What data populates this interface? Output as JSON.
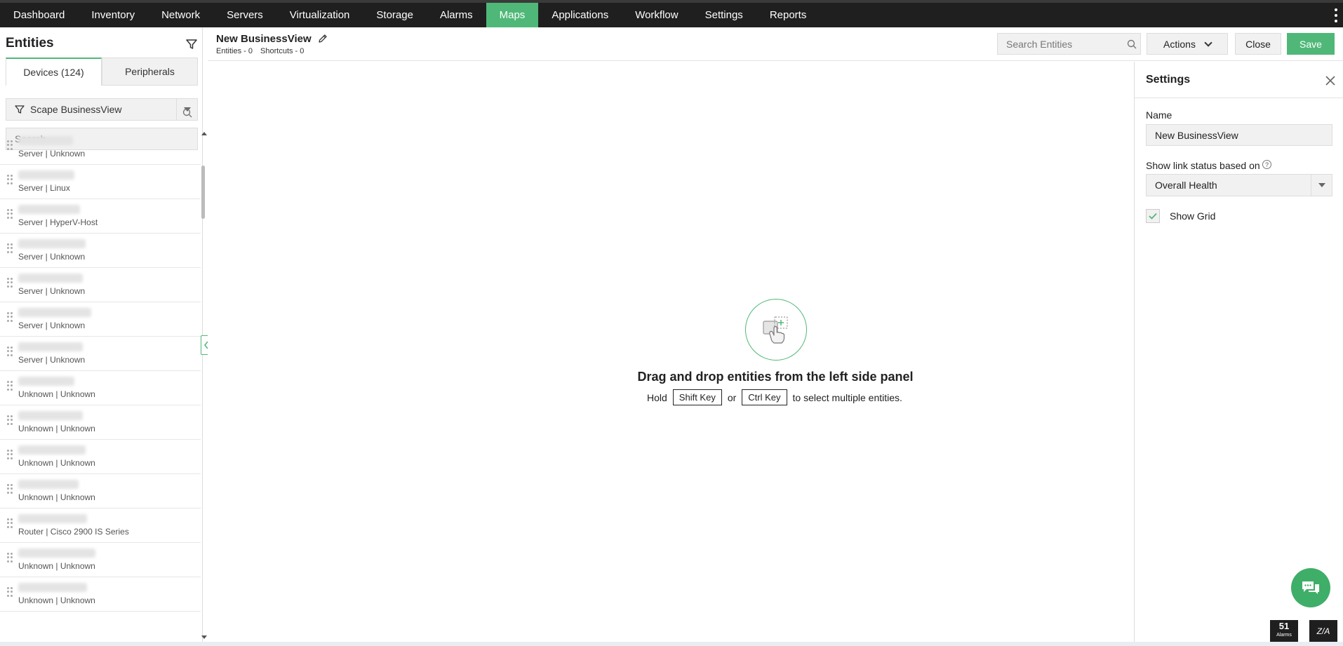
{
  "nav": {
    "items": [
      "Dashboard",
      "Inventory",
      "Network",
      "Servers",
      "Virtualization",
      "Storage",
      "Alarms",
      "Maps",
      "Applications",
      "Workflow",
      "Settings",
      "Reports"
    ],
    "active": "Maps"
  },
  "left": {
    "title": "Entities",
    "tabs": [
      "Devices (124)",
      "Peripherals"
    ],
    "scope_label": "Scape BusinessView",
    "search_placeholder": "Search",
    "entities": [
      "Server | Unknown",
      "Server | Linux",
      "Server | HyperV-Host",
      "Server | Unknown",
      "Server | Unknown",
      "Server | Unknown",
      "Server | Unknown",
      "Unknown | Unknown",
      "Unknown | Unknown",
      "Unknown | Unknown",
      "Unknown | Unknown",
      "Router | Cisco 2900 IS Series",
      "Unknown | Unknown",
      "Unknown | Unknown"
    ]
  },
  "header": {
    "title": "New BusinessView",
    "entities_count": "Entities - 0",
    "shortcuts_count": "Shortcuts - 0",
    "search_placeholder": "Search Entities",
    "actions_label": "Actions",
    "close_label": "Close",
    "save_label": "Save"
  },
  "canvas": {
    "drop_title": "Drag and drop entities from the left side panel",
    "hint_hold": "Hold",
    "hint_key1": "Shift Key",
    "hint_or": "or",
    "hint_key2": "Ctrl Key",
    "hint_tail": "to select multiple entities."
  },
  "settings": {
    "title": "Settings",
    "name_label": "Name",
    "name_value": "New BusinessView",
    "link_status_label": "Show link status based on",
    "help_mark": "?",
    "link_status_value": "Overall Health",
    "show_grid_label": "Show Grid",
    "show_grid_checked": true
  },
  "footer": {
    "alarms_count": "51",
    "alarms_label": "Alarms",
    "brand": "Z/A"
  },
  "colors": {
    "accent": "#4fb878",
    "nav_bg": "#1f1f1f"
  }
}
